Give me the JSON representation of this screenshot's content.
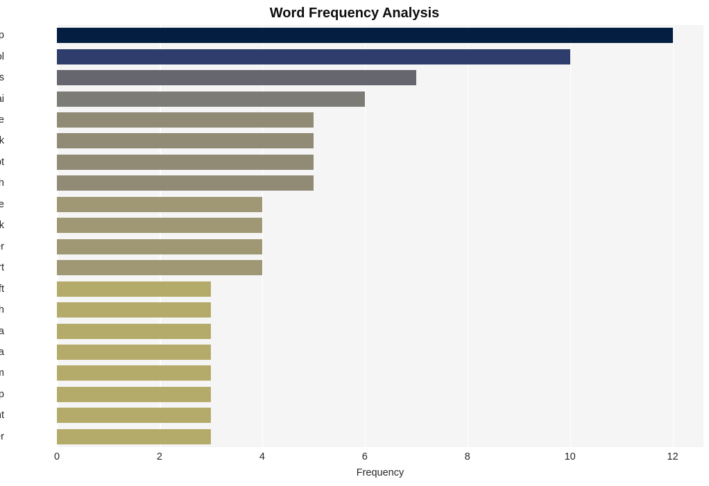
{
  "chart_data": {
    "type": "bar",
    "orientation": "horizontal",
    "title": "Word Frequency Analysis",
    "xlabel": "Frequency",
    "ylabel": "",
    "categories": [
      "group",
      "tool",
      "hackers",
      "openai",
      "base",
      "hack",
      "chatgpt",
      "research",
      "state",
      "back",
      "hacker",
      "report",
      "microsoft",
      "north",
      "korea",
      "china",
      "platform",
      "develop",
      "content",
      "cyber"
    ],
    "values": [
      12,
      10,
      7,
      6,
      5,
      5,
      5,
      5,
      4,
      4,
      4,
      4,
      3,
      3,
      3,
      3,
      3,
      3,
      3,
      3
    ],
    "bar_colors": [
      "#041e42",
      "#2e3d6b",
      "#65666e",
      "#7c7b76",
      "#918b76",
      "#918b76",
      "#918b76",
      "#918b76",
      "#a09874",
      "#a09874",
      "#a09874",
      "#a09874",
      "#b4aa6a",
      "#b4aa6a",
      "#b4aa6a",
      "#b4aa6a",
      "#b4aa6a",
      "#b4aa6a",
      "#b4aa6a",
      "#b4aa6a"
    ],
    "xticks": [
      0,
      2,
      4,
      6,
      8,
      10,
      12
    ],
    "xlim": [
      0,
      12.6
    ],
    "grid": true,
    "grid_axis": "x",
    "grid_color": "#ffffff",
    "plot_background": "#f5f5f5",
    "figure_background": "#ffffff",
    "legend": null
  }
}
